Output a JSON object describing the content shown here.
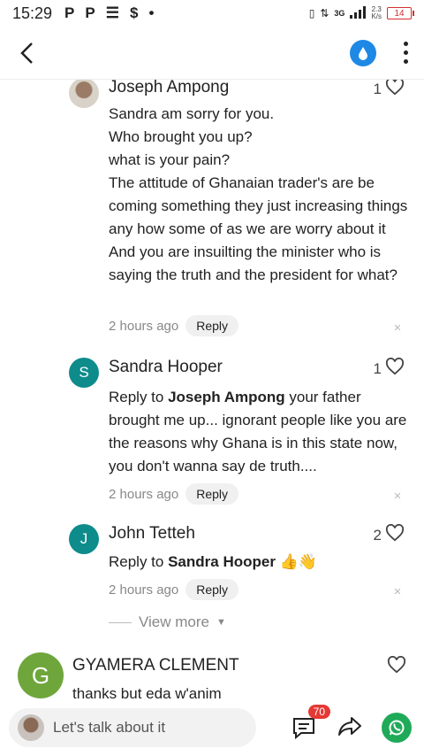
{
  "status": {
    "time": "15:29",
    "notification_icons": [
      "P",
      "P",
      "☰",
      "$",
      "•"
    ],
    "network": "3G",
    "speed_top": "2.3",
    "speed_bottom": "K/s",
    "battery": "14"
  },
  "comments": [
    {
      "author": "Joseph Ampong",
      "likes": "1",
      "lines": [
        "Sandra am sorry for you.",
        "Who brought you up?",
        "what is your pain?",
        "The attitude of Ghanaian trader's are be coming something they just increasing things any how some of as we are worry about it And you are insuilting the minister who is saying the truth and the president for what?"
      ],
      "time": "2 hours ago",
      "reply_label": "Reply"
    },
    {
      "author": "Sandra Hooper",
      "avatar_letter": "S",
      "likes": "1",
      "reply_prefix": "Reply to ",
      "reply_target": "Joseph Ampong",
      "body": " your father brought me up... ignorant people like you are the reasons why Ghana is in this state now, you don't wanna say de truth....",
      "time": "2 hours ago",
      "reply_label": "Reply"
    },
    {
      "author": "John Tetteh",
      "avatar_letter": "J",
      "likes": "2",
      "reply_prefix": "Reply to ",
      "reply_target": "Sandra Hooper",
      "body": " 👍👋",
      "time": "2 hours ago",
      "reply_label": "Reply"
    }
  ],
  "view_more": "View more",
  "top_comment": {
    "avatar_letter": "G",
    "author": "GYAMERA CLEMENT",
    "text": "thanks but eda w'anim"
  },
  "bottom": {
    "placeholder": "Let's talk about it",
    "comment_count": "70"
  },
  "colors": {
    "accent_blue": "#1e88e5",
    "teal_avatar": "#0e8c8c",
    "green_avatar": "#6fa63c",
    "badge_red": "#e53935",
    "whatsapp_green": "#1faa59"
  }
}
